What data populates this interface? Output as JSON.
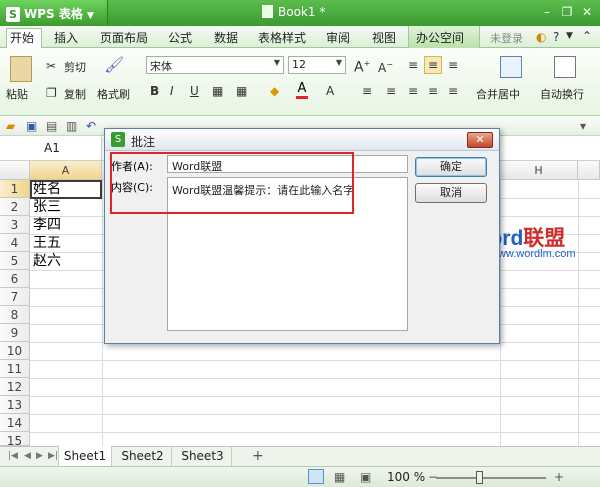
{
  "app": {
    "name": "WPS 表格",
    "logo": "S",
    "doc_title": "Book1 *"
  },
  "tabs": [
    "开始",
    "插入",
    "页面布局",
    "公式",
    "数据",
    "表格样式",
    "审阅",
    "视图",
    "办公空间"
  ],
  "login": "未登录",
  "ribbon": {
    "cut": "剪切",
    "paste": "粘贴",
    "copy": "复制",
    "format_painter": "格式刷",
    "font": "宋体",
    "font_size": "12",
    "merge_center": "合并居中",
    "auto_wrap": "自动换行"
  },
  "formula": {
    "name_box": "A1"
  },
  "columns": [
    "A",
    "H"
  ],
  "rows": [
    "1",
    "2",
    "3",
    "4",
    "5",
    "6",
    "7",
    "8",
    "9",
    "10",
    "11",
    "12",
    "13",
    "14",
    "15"
  ],
  "cells": [
    "姓名",
    "张三",
    "李四",
    "王五",
    "赵六"
  ],
  "sheets": [
    "Sheet1",
    "Sheet2",
    "Sheet3"
  ],
  "status": {
    "zoom": "100 %"
  },
  "dialog": {
    "icon": "S",
    "title": "批注",
    "author_label": "作者(A):",
    "author_value": "Word联盟",
    "content_label": "内容(C):",
    "content_value": "Word联盟温馨提示：请在此输入名字",
    "ok": "确定",
    "cancel": "取消"
  },
  "watermark": {
    "brand_a": "Word",
    "brand_b": "联盟",
    "url": "www.wordlm.com"
  },
  "colors": {
    "accent": "#3b9a30",
    "highlight_box": "#e0242b"
  }
}
